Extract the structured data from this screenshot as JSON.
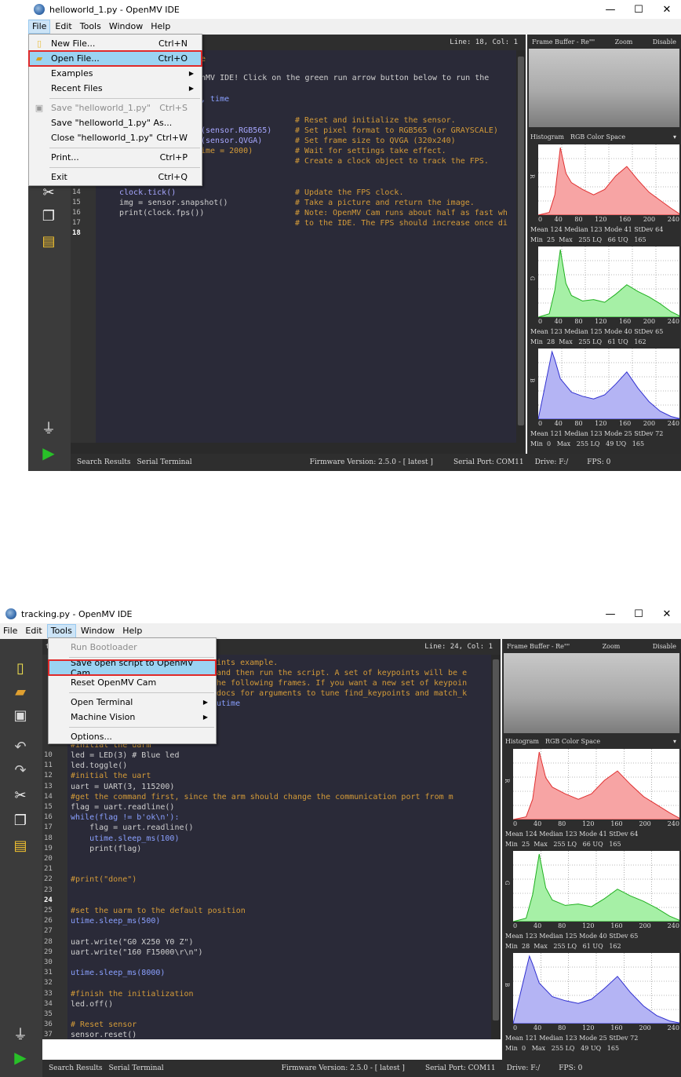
{
  "window1": {
    "title": "helloworld_1.py - OpenMV IDE",
    "menu": [
      "File",
      "Edit",
      "Tools",
      "Window",
      "Help"
    ],
    "cursor_pos": "Line: 18, Col: 1",
    "file_menu": {
      "items": [
        {
          "label": "New File...",
          "shortcut": "Ctrl+N"
        },
        {
          "label": "Open File...",
          "shortcut": "Ctrl+O"
        },
        {
          "label": "Examples",
          "shortcut": ""
        },
        {
          "label": "Recent Files",
          "shortcut": ""
        },
        {
          "label": "Save \"helloworld_1.py\"",
          "shortcut": "Ctrl+S"
        },
        {
          "label": "Save \"helloworld_1.py\" As...",
          "shortcut": ""
        },
        {
          "label": "Close \"helloworld_1.py\"",
          "shortcut": "Ctrl+W"
        },
        {
          "label": "Print...",
          "shortcut": "Ctrl+P"
        },
        {
          "label": "Exit",
          "shortcut": "Ctrl+Q"
        }
      ]
    },
    "code_fragments": {
      "l_a": "e",
      "l_b": "nMV IDE! Click on the green run arrow button below to run the",
      "l_c": ", time",
      "l_d1": "# Reset and initialize the sensor.",
      "l_e1": "(sensor.RGB565)",
      "l_e2": "# Set pixel format to RGB565 (or GRAYSCALE)",
      "l_f1": "(sensor.QVGA)",
      "l_f2": "# Set frame size to QVGA (320x240)",
      "l_g1": "ime = 2000)",
      "l_g2": "# Wait for settings take effect.",
      "l_h": "# Create a clock object to track the FPS.",
      "l14": "clock.tick()",
      "l14c": "# Update the FPS clock.",
      "l15": "img = sensor.snapshot()",
      "l15c": "# Take a picture and return the image.",
      "l16": "print(clock.fps())",
      "l16c": "# Note: OpenMV Cam runs about half as fast wh",
      "l17c": "# to the IDE. The FPS should increase once di"
    },
    "gutter": [
      "14",
      "15",
      "16",
      "17",
      "18"
    ],
    "status": {
      "search": "Search Results",
      "serial": "Serial Terminal",
      "firmware": "Firmware Version: 2.5.0 - [ latest ]",
      "port": "Serial Port: COM11",
      "drive": "Drive: F:/",
      "fps": "FPS: 0"
    }
  },
  "window2": {
    "title": "tracking.py - OpenMV IDE",
    "menu": [
      "File",
      "Edit",
      "Tools",
      "Window",
      "Help"
    ],
    "cursor_pos": "Line: 24, Col: 1",
    "tab_frag": "t",
    "tools_menu": {
      "items": [
        {
          "label": "Run Bootloader"
        },
        {
          "label": "Save open script to OpenMV Cam"
        },
        {
          "label": "Reset OpenMV Cam"
        },
        {
          "label": "Open Terminal"
        },
        {
          "label": "Machine Vision"
        },
        {
          "label": "Options..."
        }
      ]
    },
    "code_frag_top": [
      "ints example.",
      "and then run the script. A set of keypoints will be e",
      "he following frames. If you want a new set of keypoin",
      "docs for arguments to tune find_keypoints and match_k",
      "utime"
    ],
    "code_frag_9": "#initial the uarm",
    "lines": [
      {
        "n": "10",
        "t": "led = LED(3) # Blue led"
      },
      {
        "n": "11",
        "t": "led.toggle()"
      },
      {
        "n": "12",
        "t": "#initial the uart"
      },
      {
        "n": "13",
        "t": "uart = UART(3, 115200)"
      },
      {
        "n": "14",
        "t": "#get the command first, since the arm should change the communication port from m"
      },
      {
        "n": "15",
        "t": "flag = uart.readline()"
      },
      {
        "n": "16",
        "t": "while(flag != b'ok\\n'):"
      },
      {
        "n": "17",
        "t": "    flag = uart.readline()"
      },
      {
        "n": "18",
        "t": "    utime.sleep_ms(100)"
      },
      {
        "n": "19",
        "t": "    print(flag)"
      },
      {
        "n": "20",
        "t": ""
      },
      {
        "n": "21",
        "t": ""
      },
      {
        "n": "22",
        "t": "#print(\"done\")"
      },
      {
        "n": "23",
        "t": ""
      },
      {
        "n": "24",
        "t": ""
      },
      {
        "n": "25",
        "t": "#set the uarm to the default position"
      },
      {
        "n": "26",
        "t": "utime.sleep_ms(500)"
      },
      {
        "n": "27",
        "t": ""
      },
      {
        "n": "28",
        "t": "uart.write(\"G0 X250 Y0 Z\")"
      },
      {
        "n": "29",
        "t": "uart.write(\"160 F15000\\r\\n\")"
      },
      {
        "n": "30",
        "t": ""
      },
      {
        "n": "31",
        "t": "utime.sleep_ms(8000)"
      },
      {
        "n": "32",
        "t": ""
      },
      {
        "n": "33",
        "t": "#finish the initialization"
      },
      {
        "n": "34",
        "t": "led.off()"
      },
      {
        "n": "35",
        "t": ""
      },
      {
        "n": "36",
        "t": "# Reset sensor"
      },
      {
        "n": "37",
        "t": "sensor.reset()"
      }
    ],
    "status": {
      "search": "Search Results",
      "serial": "Serial Terminal",
      "firmware": "Firmware Version: 2.5.0 - [ latest ]",
      "port": "Serial Port: COM11",
      "drive": "Drive: F:/",
      "fps": "FPS: 0"
    }
  },
  "panel": {
    "frame_buffer": "Frame Buffer - Re\"\"",
    "zoom": "Zoom",
    "disable": "Disable",
    "histogram": "Histogram",
    "color_space": "RGB Color Space",
    "ticks": [
      "0",
      "40",
      "80",
      "120",
      "160",
      "200",
      "240"
    ],
    "channels": [
      {
        "axis": "R",
        "color": "#f7a4a4",
        "line": "#e03030",
        "stats1": "Mean 124 Median 123 Mode 41 StDev 64",
        "stats2": "Min  25  Max   255 LQ   66 UQ   165"
      },
      {
        "axis": "G",
        "color": "#a6f0a6",
        "line": "#20b020",
        "stats1": "Mean 123 Median 125 Mode 40 StDev 65",
        "stats2": "Min  28  Max   255 LQ   61 UQ   162"
      },
      {
        "axis": "B",
        "color": "#b4b4f4",
        "line": "#3030d0",
        "stats1": "Mean 121 Median 123 Mode 25 StDev 72",
        "stats2": "Min  0   Max   255 LQ   49 UQ   165"
      }
    ]
  },
  "chart_data": [
    {
      "type": "area",
      "title": "R",
      "x": [
        0,
        20,
        30,
        40,
        50,
        60,
        80,
        100,
        120,
        140,
        160,
        180,
        200,
        220,
        240,
        255
      ],
      "values": [
        0,
        4,
        30,
        100,
        62,
        48,
        38,
        30,
        38,
        58,
        72,
        52,
        34,
        22,
        10,
        2
      ]
    },
    {
      "type": "area",
      "title": "G",
      "x": [
        0,
        20,
        30,
        40,
        50,
        60,
        80,
        100,
        120,
        140,
        160,
        180,
        200,
        220,
        240,
        255
      ],
      "values": [
        0,
        5,
        40,
        100,
        50,
        32,
        24,
        26,
        22,
        34,
        48,
        38,
        30,
        20,
        8,
        2
      ]
    },
    {
      "type": "area",
      "title": "B",
      "x": [
        0,
        10,
        20,
        25,
        30,
        40,
        60,
        80,
        100,
        120,
        140,
        160,
        180,
        200,
        220,
        240,
        255
      ],
      "values": [
        0,
        40,
        80,
        100,
        88,
        60,
        40,
        34,
        30,
        36,
        52,
        70,
        46,
        26,
        12,
        4,
        1
      ]
    }
  ]
}
